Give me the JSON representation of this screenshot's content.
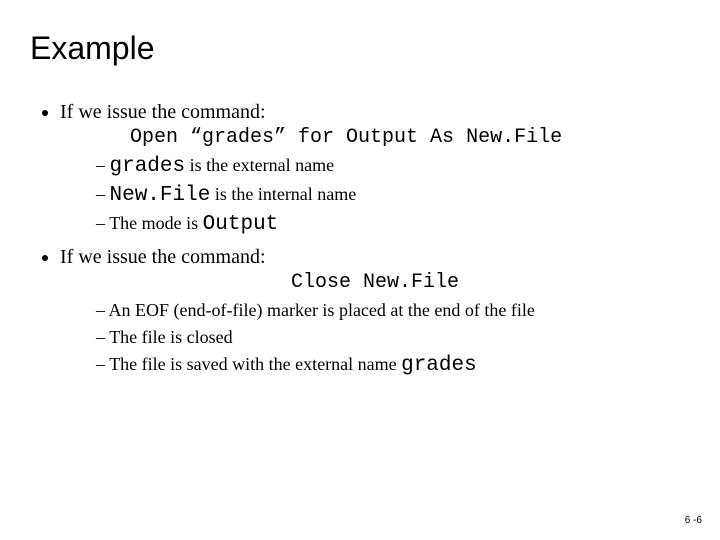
{
  "title": "Example",
  "b1": {
    "lead": "If we issue the command:",
    "cmd_parts": [
      "Open ",
      "“grades”",
      " for Output As ",
      "New.File"
    ],
    "sub": [
      {
        "code": "grades",
        "rest": " is the external name"
      },
      {
        "code": "New.File",
        "rest": " is the internal name"
      },
      {
        "plain": "The mode is ",
        "code_after": "Output"
      }
    ]
  },
  "b2": {
    "lead": "If we issue the command:",
    "cmd_parts": [
      "Close ",
      "New.File"
    ],
    "sub": [
      {
        "plain": " An EOF (end-of-file) marker is placed at the end of the file"
      },
      {
        "plain": "The file is closed"
      },
      {
        "plain": "The file is saved with the external name ",
        "code_after": "grades"
      }
    ]
  },
  "footer": "6 -6"
}
